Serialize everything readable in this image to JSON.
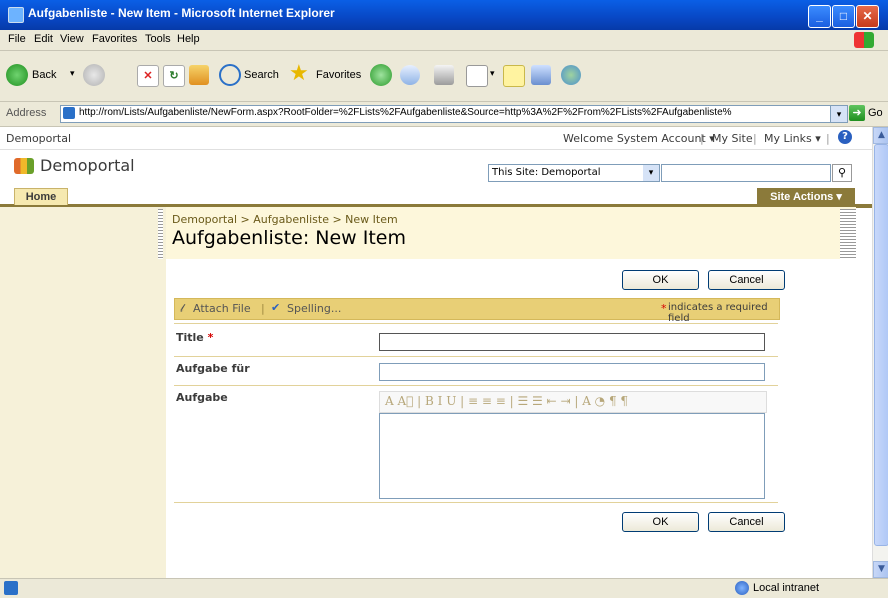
{
  "window": {
    "title": "Aufgabenliste - New Item - Microsoft Internet Explorer",
    "min": "_",
    "max": "□",
    "close": "✕"
  },
  "menu": [
    "File",
    "Edit",
    "View",
    "Favorites",
    "Tools",
    "Help"
  ],
  "toolbar": {
    "back": "Back",
    "search": "Search",
    "favorites": "Favorites"
  },
  "address": {
    "label": "Address",
    "url": "http://rom/Lists/Aufgabenliste/NewForm.aspx?RootFolder=%2FLists%2FAufgabenliste&Source=http%3A%2F%2From%2FLists%2FAufgabenliste%",
    "go": "Go"
  },
  "sp": {
    "site_name_top": "Demoportal",
    "welcome": "Welcome System Account",
    "my_site": "My Site",
    "my_links": "My Links",
    "logo_title": "Demoportal",
    "search_scope": "This Site: Demoportal",
    "home_tab": "Home",
    "site_actions": "Site Actions",
    "breadcrumb": "Demoportal > Aufgabenliste > New Item",
    "page_title": "Aufgabenliste: New Item"
  },
  "form": {
    "ok": "OK",
    "cancel": "Cancel",
    "attach_file": "Attach File",
    "spelling": "Spelling...",
    "required_star": "*",
    "required_note": "indicates a required field",
    "fields": [
      {
        "label": "Title",
        "required": "*",
        "value": ""
      },
      {
        "label": "Aufgabe für",
        "value": ""
      },
      {
        "label": "Aufgabe",
        "value": ""
      }
    ],
    "rte_tools": "A A⃞ | B I U | ≡ ≡ ≡ | ☰ ☰ ⇤ ⇥ | A ◔ ¶ ¶"
  },
  "status": {
    "zone": "Local intranet"
  },
  "colors": {
    "accent": "#8b7a3a",
    "nav_bg": "#f6f1d9",
    "title_bg": "#fdf7db",
    "attach_bar": "#e8cf76",
    "required": "#d40000"
  }
}
